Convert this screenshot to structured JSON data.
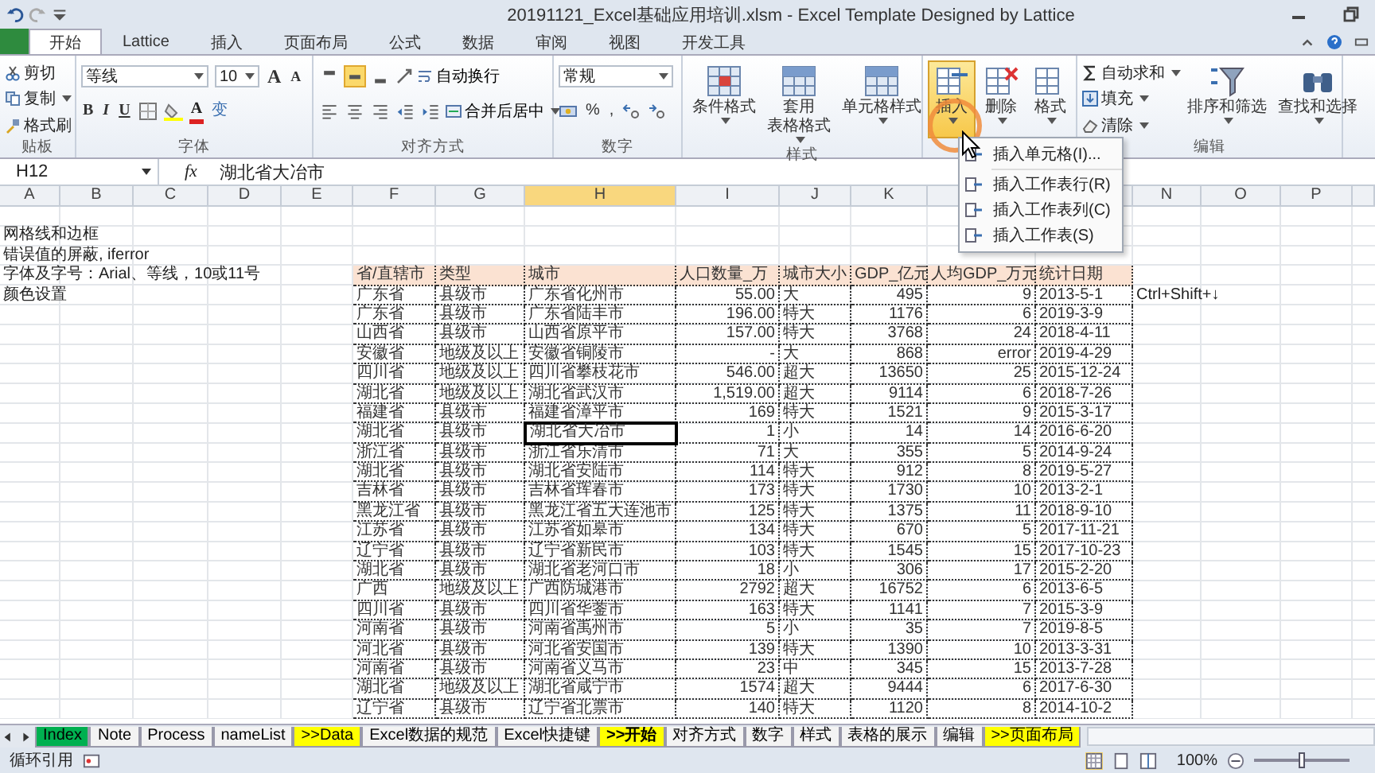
{
  "window": {
    "title": "20191121_Excel基础应用培训.xlsm - Excel Template Designed by Lattice"
  },
  "tabs": [
    {
      "label": "开始",
      "selected": true
    },
    {
      "label": "Lattice",
      "selected": false
    },
    {
      "label": "插入",
      "selected": false
    },
    {
      "label": "页面布局",
      "selected": false
    },
    {
      "label": "公式",
      "selected": false
    },
    {
      "label": "数据",
      "selected": false
    },
    {
      "label": "审阅",
      "selected": false
    },
    {
      "label": "视图",
      "selected": false
    },
    {
      "label": "开发工具",
      "selected": false
    }
  ],
  "ribbon": {
    "clipboard": {
      "label": "贴板",
      "items": [
        "剪切",
        "复制",
        "格式刷"
      ]
    },
    "font": {
      "label": "字体",
      "name": "等线",
      "size": "10",
      "grow": "A",
      "shrink": "A",
      "styles": [
        "B",
        "I",
        "U"
      ],
      "color_letter": "A",
      "phonetic": "变"
    },
    "alignment": {
      "label": "对齐方式",
      "vertical": [
        {
          "selected": false
        },
        {
          "selected": true
        },
        {
          "selected": false
        }
      ],
      "wrap": "自动换行",
      "merge": "合并后居中"
    },
    "number": {
      "label": "数字",
      "format": "常规",
      "percent": "%",
      "comma": ","
    },
    "styles": {
      "label": "样式",
      "buttons": [
        {
          "lines": [
            "条件格式"
          ]
        },
        {
          "lines": [
            "套用",
            "表格格式"
          ]
        },
        {
          "lines": [
            "单元格样式"
          ]
        }
      ]
    },
    "cells": {
      "buttons": [
        {
          "label": "插入",
          "selected": true
        },
        {
          "label": "删除",
          "selected": false
        },
        {
          "label": "格式",
          "selected": false
        }
      ]
    },
    "editing": {
      "label": "编辑",
      "small": [
        "自动求和",
        "填充",
        "清除"
      ],
      "large": [
        "排序和筛选",
        "查找和选择"
      ]
    }
  },
  "menu": {
    "items": [
      "插入单元格(I)...",
      "插入工作表行(R)",
      "插入工作表列(C)",
      "插入工作表(S)"
    ]
  },
  "formula_bar": {
    "name_box": "H12",
    "fx": "fx",
    "content": "湖北省大冶市"
  },
  "sheet": {
    "columns": [
      {
        "letter": "A",
        "selected": false
      },
      {
        "letter": "B",
        "selected": false
      },
      {
        "letter": "C",
        "selected": false
      },
      {
        "letter": "D",
        "selected": false
      },
      {
        "letter": "E",
        "selected": false
      },
      {
        "letter": "F",
        "selected": false
      },
      {
        "letter": "G",
        "selected": false
      },
      {
        "letter": "H",
        "selected": true
      },
      {
        "letter": "I",
        "selected": false
      },
      {
        "letter": "J",
        "selected": false
      },
      {
        "letter": "K",
        "selected": false
      },
      {
        "selected": false
      },
      {
        "selected": false
      },
      {
        "letter": "N",
        "selected": false
      },
      {
        "letter": "O",
        "selected": false
      },
      {
        "letter": "P",
        "selected": false
      }
    ],
    "notes": [
      "网格线和边框",
      "错误值的屏蔽, iferror",
      "字体及字号：Arial、等线，10或11号",
      "颜色设置"
    ],
    "side_note": "Ctrl+Shift+↓",
    "table": {
      "columns": [
        {
          "label": "省/直辖市",
          "kind": "text"
        },
        {
          "label": "类型",
          "kind": "text"
        },
        {
          "label": "城市",
          "kind": "text"
        },
        {
          "label": "人口数量_万",
          "kind": "number"
        },
        {
          "label": "城市大小",
          "kind": "text"
        },
        {
          "label": "GDP_亿元",
          "kind": "number"
        },
        {
          "label": "人均GDP_万元",
          "kind": "number"
        },
        {
          "label": "统计日期",
          "kind": "text"
        }
      ],
      "rows": [
        {
          "selected": false,
          "cells": [
            "广东省",
            "县级市",
            "广东省化州市",
            "55.00",
            "大",
            "495",
            "9",
            "2013-5-1"
          ]
        },
        {
          "selected": false,
          "cells": [
            "广东省",
            "县级市",
            "广东省陆丰市",
            "196.00",
            "特大",
            "1176",
            "6",
            "2019-3-9"
          ]
        },
        {
          "selected": false,
          "cells": [
            "山西省",
            "县级市",
            "山西省原平市",
            "157.00",
            "特大",
            "3768",
            "24",
            "2018-4-11"
          ]
        },
        {
          "selected": false,
          "cells": [
            "安徽省",
            "地级及以上",
            "安徽省铜陵市",
            "-",
            "大",
            "868",
            "error",
            "2019-4-29"
          ]
        },
        {
          "selected": false,
          "cells": [
            "四川省",
            "地级及以上",
            "四川省攀枝花市",
            "546.00",
            "超大",
            "13650",
            "25",
            "2015-12-24"
          ]
        },
        {
          "selected": false,
          "cells": [
            "湖北省",
            "地级及以上",
            "湖北省武汉市",
            "1,519.00",
            "超大",
            "9114",
            "6",
            "2018-7-26"
          ]
        },
        {
          "selected": false,
          "cells": [
            "福建省",
            "县级市",
            "福建省漳平市",
            "169",
            "特大",
            "1521",
            "9",
            "2015-3-17"
          ]
        },
        {
          "selected": true,
          "cells": [
            "湖北省",
            "县级市",
            "湖北省大冶市",
            "1",
            "小",
            "14",
            "14",
            "2016-6-20"
          ]
        },
        {
          "selected": false,
          "cells": [
            "浙江省",
            "县级市",
            "浙江省乐清市",
            "71",
            "大",
            "355",
            "5",
            "2014-9-24"
          ]
        },
        {
          "selected": false,
          "cells": [
            "湖北省",
            "县级市",
            "湖北省安陆市",
            "114",
            "特大",
            "912",
            "8",
            "2019-5-27"
          ]
        },
        {
          "selected": false,
          "cells": [
            "吉林省",
            "县级市",
            "吉林省珲春市",
            "173",
            "特大",
            "1730",
            "10",
            "2013-2-1"
          ]
        },
        {
          "selected": false,
          "cells": [
            "黑龙江省",
            "县级市",
            "黑龙江省五大连池市",
            "125",
            "特大",
            "1375",
            "11",
            "2018-9-10"
          ]
        },
        {
          "selected": false,
          "cells": [
            "江苏省",
            "县级市",
            "江苏省如皋市",
            "134",
            "特大",
            "670",
            "5",
            "2017-11-21"
          ]
        },
        {
          "selected": false,
          "cells": [
            "辽宁省",
            "县级市",
            "辽宁省新民市",
            "103",
            "特大",
            "1545",
            "15",
            "2017-10-23"
          ]
        },
        {
          "selected": false,
          "cells": [
            "湖北省",
            "县级市",
            "湖北省老河口市",
            "18",
            "小",
            "306",
            "17",
            "2015-2-20"
          ]
        },
        {
          "selected": false,
          "cells": [
            "广西",
            "地级及以上",
            "广西防城港市",
            "2792",
            "超大",
            "16752",
            "6",
            "2013-6-5"
          ]
        },
        {
          "selected": false,
          "cells": [
            "四川省",
            "县级市",
            "四川省华蓥市",
            "163",
            "特大",
            "1141",
            "7",
            "2015-3-9"
          ]
        },
        {
          "selected": false,
          "cells": [
            "河南省",
            "县级市",
            "河南省禹州市",
            "5",
            "小",
            "35",
            "7",
            "2019-8-5"
          ]
        },
        {
          "selected": false,
          "cells": [
            "河北省",
            "县级市",
            "河北省安国市",
            "139",
            "特大",
            "1390",
            "10",
            "2013-3-31"
          ]
        },
        {
          "selected": false,
          "cells": [
            "河南省",
            "县级市",
            "河南省义马市",
            "23",
            "中",
            "345",
            "15",
            "2013-7-28"
          ]
        },
        {
          "selected": false,
          "cells": [
            "湖北省",
            "地级及以上",
            "湖北省咸宁市",
            "1574",
            "超大",
            "9444",
            "6",
            "2017-6-30"
          ]
        },
        {
          "selected": false,
          "cells": [
            "辽宁省",
            "县级市",
            "辽宁省北票市",
            "140",
            "特大",
            "1120",
            "8",
            "2014-10-2"
          ]
        }
      ]
    }
  },
  "sheet_tabs": [
    {
      "label": "Index",
      "color": "#00b050",
      "selected": false
    },
    {
      "label": "Note",
      "selected": false
    },
    {
      "label": "Process",
      "selected": false
    },
    {
      "label": "nameList",
      "selected": false
    },
    {
      "label": ">>Data",
      "color": "#ffff00",
      "selected": false
    },
    {
      "label": "Excel数据的规范",
      "selected": false
    },
    {
      "label": "Excel快捷键",
      "selected": false
    },
    {
      "label": ">>开始",
      "color": "#ffff00",
      "selected": true
    },
    {
      "label": "对齐方式",
      "selected": false
    },
    {
      "label": "数字",
      "selected": false
    },
    {
      "label": "样式",
      "selected": false
    },
    {
      "label": "表格的展示",
      "selected": false
    },
    {
      "label": "编辑",
      "selected": false
    },
    {
      "label": ">>页面布局",
      "color": "#ffff00",
      "selected": false
    }
  ],
  "status_bar": {
    "mode": "循环引用",
    "zoom": "100%",
    "zoom_slider": {
      "level": 0.5
    }
  }
}
